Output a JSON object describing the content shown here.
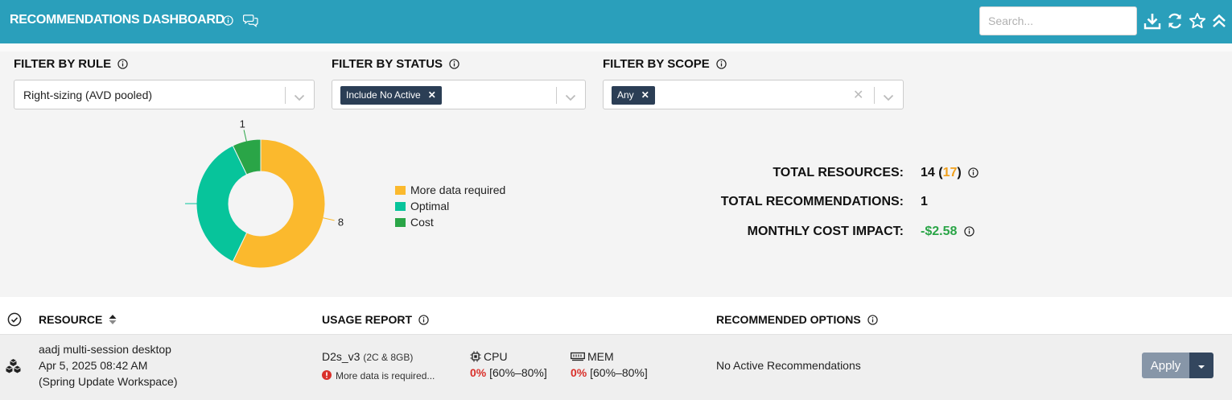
{
  "header": {
    "title": "RECOMMENDATIONS DASHBOARD",
    "search_placeholder": "Search..."
  },
  "filters": {
    "rule": {
      "label": "FILTER BY RULE",
      "value": "Right-sizing (AVD pooled)"
    },
    "status": {
      "label": "FILTER BY STATUS",
      "chip": "Include No Active"
    },
    "scope": {
      "label": "FILTER BY SCOPE",
      "chip": "Any"
    }
  },
  "chart_data": {
    "type": "pie",
    "donut": true,
    "categories": [
      "More data required",
      "Optimal",
      "Cost"
    ],
    "values": [
      8,
      5,
      1
    ],
    "colors": [
      "#fbb92d",
      "#07c49b",
      "#2aa547"
    ]
  },
  "totals": {
    "resources_label": "TOTAL RESOURCES:",
    "resources_value": "14",
    "resources_extra": "17",
    "recommendations_label": "TOTAL RECOMMENDATIONS:",
    "recommendations_value": "1",
    "cost_label": "MONTHLY COST IMPACT:",
    "cost_value": "-$2.58"
  },
  "table": {
    "headers": {
      "resource": "RESOURCE",
      "usage": "USAGE REPORT",
      "options": "RECOMMENDED OPTIONS"
    },
    "rows": [
      {
        "name": "aadj multi-session desktop",
        "date": "Apr 5, 2025 08:42 AM",
        "workspace": "(Spring Update Workspace)",
        "size": "D2s_v3",
        "size_detail": "(2C & 8GB)",
        "warning": "More data is required...",
        "cpu_label": "CPU",
        "cpu_value": "0%",
        "cpu_range": "[60%–80%]",
        "mem_label": "MEM",
        "mem_value": "0%",
        "mem_range": "[60%–80%]",
        "recommendation": "No Active Recommendations",
        "apply_label": "Apply"
      }
    ]
  },
  "colors": {
    "header_bg": "#2a9fbb",
    "chip_bg": "#2b3e55",
    "cost_green": "#2aa547",
    "warn_orange": "#f0a01c",
    "usage_red": "#d9302a"
  }
}
